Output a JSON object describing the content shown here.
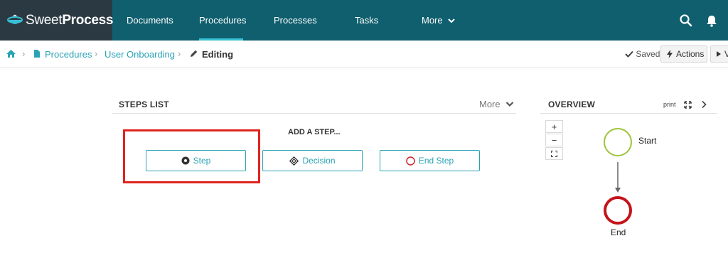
{
  "header": {
    "brand_light": "Sweet",
    "brand_bold": "Process",
    "nav": [
      {
        "label": "Documents"
      },
      {
        "label": "Procedures"
      },
      {
        "label": "Processes"
      },
      {
        "label": "Tasks"
      },
      {
        "label": "More"
      }
    ]
  },
  "breadcrumb": {
    "procedures": "Procedures",
    "item": "User Onboarding",
    "mode": "Editing"
  },
  "status": {
    "saved": "Saved",
    "actions": "Actions",
    "view": "V"
  },
  "steps_list": {
    "title": "STEPS LIST",
    "more": "More",
    "add_heading": "ADD A STEP...",
    "buttons": {
      "step": "Step",
      "decision": "Decision",
      "end": "End Step"
    }
  },
  "overview": {
    "title": "OVERVIEW",
    "print": "print",
    "zoom_in": "+",
    "zoom_out": "−",
    "start_label": "Start",
    "end_label": "End"
  },
  "colors": {
    "header_bg": "#0f5f6e",
    "logo_bg": "#2b3a42",
    "accent": "#2aa3b6",
    "highlight": "#e0231f",
    "start_node": "#9cc53a",
    "end_node": "#c4141b"
  },
  "icons": [
    "logo-cup-icon",
    "chevron-down-icon",
    "search-icon",
    "bell-icon",
    "home-icon",
    "document-icon",
    "pencil-icon",
    "check-icon",
    "bolt-icon",
    "caret-right-icon",
    "radio-dot-icon",
    "diamond-icon",
    "circle-icon",
    "expand-icon",
    "chevron-right-icon",
    "fit-icon"
  ]
}
